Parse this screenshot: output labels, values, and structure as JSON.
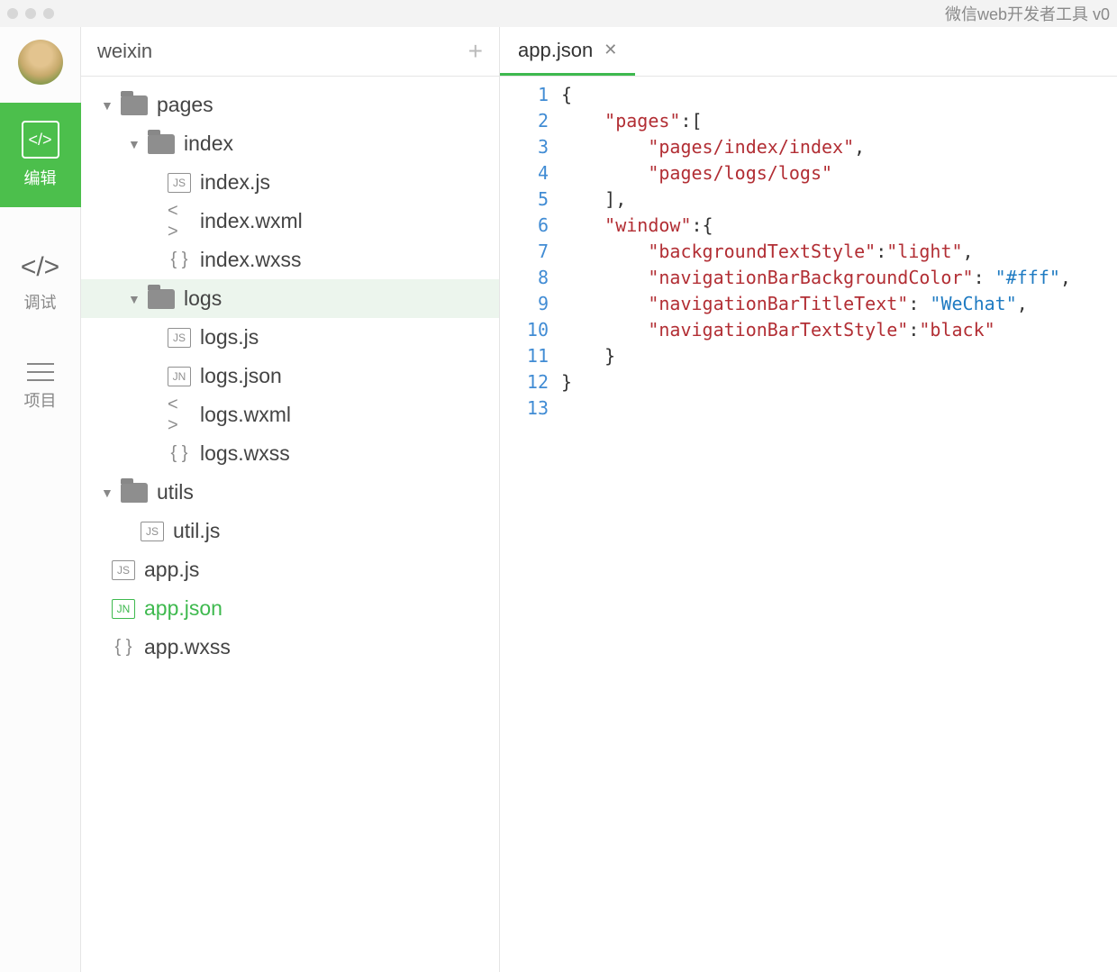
{
  "window": {
    "title": "微信web开发者工具 v0"
  },
  "sidebar": {
    "edit_label": "编辑",
    "debug_label": "调试",
    "project_label": "项目"
  },
  "project": {
    "name": "weixin"
  },
  "tree": {
    "pages_label": "pages",
    "index_folder": "index",
    "index_js": "index.js",
    "index_wxml": "index.wxml",
    "index_wxss": "index.wxss",
    "logs_folder": "logs",
    "logs_js": "logs.js",
    "logs_json": "logs.json",
    "logs_wxml": "logs.wxml",
    "logs_wxss": "logs.wxss",
    "utils_folder": "utils",
    "util_js": "util.js",
    "app_js": "app.js",
    "app_json": "app.json",
    "app_wxss": "app.wxss"
  },
  "tabs": {
    "items": [
      {
        "label": "app.json"
      }
    ]
  },
  "icon_text": {
    "js": "JS",
    "jn": "JN",
    "angles": "< >",
    "braces": "{ }",
    "code": "</>",
    "plus": "+",
    "close": "✕",
    "disclosure": "▼"
  },
  "code": {
    "lines": [
      {
        "n": 1,
        "tokens": [
          {
            "c": "p",
            "t": "{"
          }
        ]
      },
      {
        "n": 2,
        "tokens": [
          {
            "c": "p",
            "t": "    "
          },
          {
            "c": "s",
            "t": "\"pages\""
          },
          {
            "c": "p",
            "t": ":["
          }
        ]
      },
      {
        "n": 3,
        "tokens": [
          {
            "c": "p",
            "t": "        "
          },
          {
            "c": "s",
            "t": "\"pages/index/index\""
          },
          {
            "c": "p",
            "t": ","
          }
        ]
      },
      {
        "n": 4,
        "tokens": [
          {
            "c": "p",
            "t": "        "
          },
          {
            "c": "s",
            "t": "\"pages/logs/logs\""
          }
        ]
      },
      {
        "n": 5,
        "tokens": [
          {
            "c": "p",
            "t": "    ],"
          }
        ]
      },
      {
        "n": 6,
        "tokens": [
          {
            "c": "p",
            "t": "    "
          },
          {
            "c": "s",
            "t": "\"window\""
          },
          {
            "c": "p",
            "t": ":{"
          }
        ]
      },
      {
        "n": 7,
        "tokens": [
          {
            "c": "p",
            "t": "        "
          },
          {
            "c": "s",
            "t": "\"backgroundTextStyle\""
          },
          {
            "c": "p",
            "t": ":"
          },
          {
            "c": "s",
            "t": "\"light\""
          },
          {
            "c": "p",
            "t": ","
          }
        ]
      },
      {
        "n": 8,
        "tokens": [
          {
            "c": "p",
            "t": "        "
          },
          {
            "c": "s",
            "t": "\"navigationBarBackgroundColor\""
          },
          {
            "c": "p",
            "t": ": "
          },
          {
            "c": "v",
            "t": "\"#fff\""
          },
          {
            "c": "p",
            "t": ","
          }
        ]
      },
      {
        "n": 9,
        "tokens": [
          {
            "c": "p",
            "t": "        "
          },
          {
            "c": "s",
            "t": "\"navigationBarTitleText\""
          },
          {
            "c": "p",
            "t": ": "
          },
          {
            "c": "v",
            "t": "\"WeChat\""
          },
          {
            "c": "p",
            "t": ","
          }
        ]
      },
      {
        "n": 10,
        "tokens": [
          {
            "c": "p",
            "t": "        "
          },
          {
            "c": "s",
            "t": "\"navigationBarTextStyle\""
          },
          {
            "c": "p",
            "t": ":"
          },
          {
            "c": "s",
            "t": "\"black\""
          }
        ]
      },
      {
        "n": 11,
        "tokens": [
          {
            "c": "p",
            "t": "    }"
          }
        ]
      },
      {
        "n": 12,
        "tokens": [
          {
            "c": "p",
            "t": "}"
          }
        ]
      },
      {
        "n": 13,
        "tokens": [
          {
            "c": "p",
            "t": ""
          }
        ]
      }
    ]
  }
}
